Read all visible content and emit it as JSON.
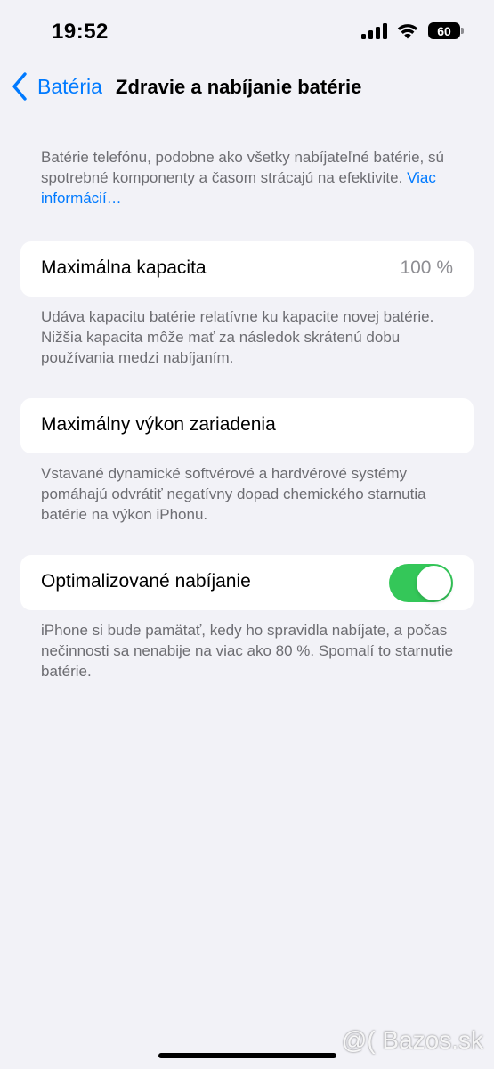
{
  "status_bar": {
    "time": "19:52",
    "battery_level": "60",
    "icons": [
      "signal-icon",
      "wifi-icon",
      "battery-icon"
    ]
  },
  "nav": {
    "back_label": "Batéria",
    "title": "Zdravie a nabíjanie batérie"
  },
  "intro": {
    "text": "Batérie telefónu, podobne ako všetky nabíjateľné batérie, sú spotrebné komponenty a časom strácajú na efektivite. ",
    "link": "Viac informácií…"
  },
  "max_capacity": {
    "label": "Maximálna kapacita",
    "value": "100 %",
    "description": "Udáva kapacitu batérie relatívne ku kapacite novej batérie. Nižšia kapacita môže mať za následok skrátenú dobu používania medzi nabíjaním."
  },
  "peak_performance": {
    "label": "Maximálny výkon zariadenia",
    "description": "Vstavané dynamické softvérové a hardvérové systémy pomáhajú odvrátiť negatívny dopad chemického starnutia batérie na výkon iPhonu."
  },
  "optimized_charging": {
    "label": "Optimalizované nabíjanie",
    "enabled": true,
    "description": "iPhone si bude pamätať, kedy ho spravidla nabíjate, a počas nečinnosti sa nenabije na viac ako 80 %. Spomalí to starnutie batérie."
  },
  "watermark": "@( Bazos.sk",
  "colors": {
    "accent": "#007aff",
    "toggle_on": "#34c759",
    "background": "#f2f2f7",
    "secondary_text": "#6d6d72"
  }
}
